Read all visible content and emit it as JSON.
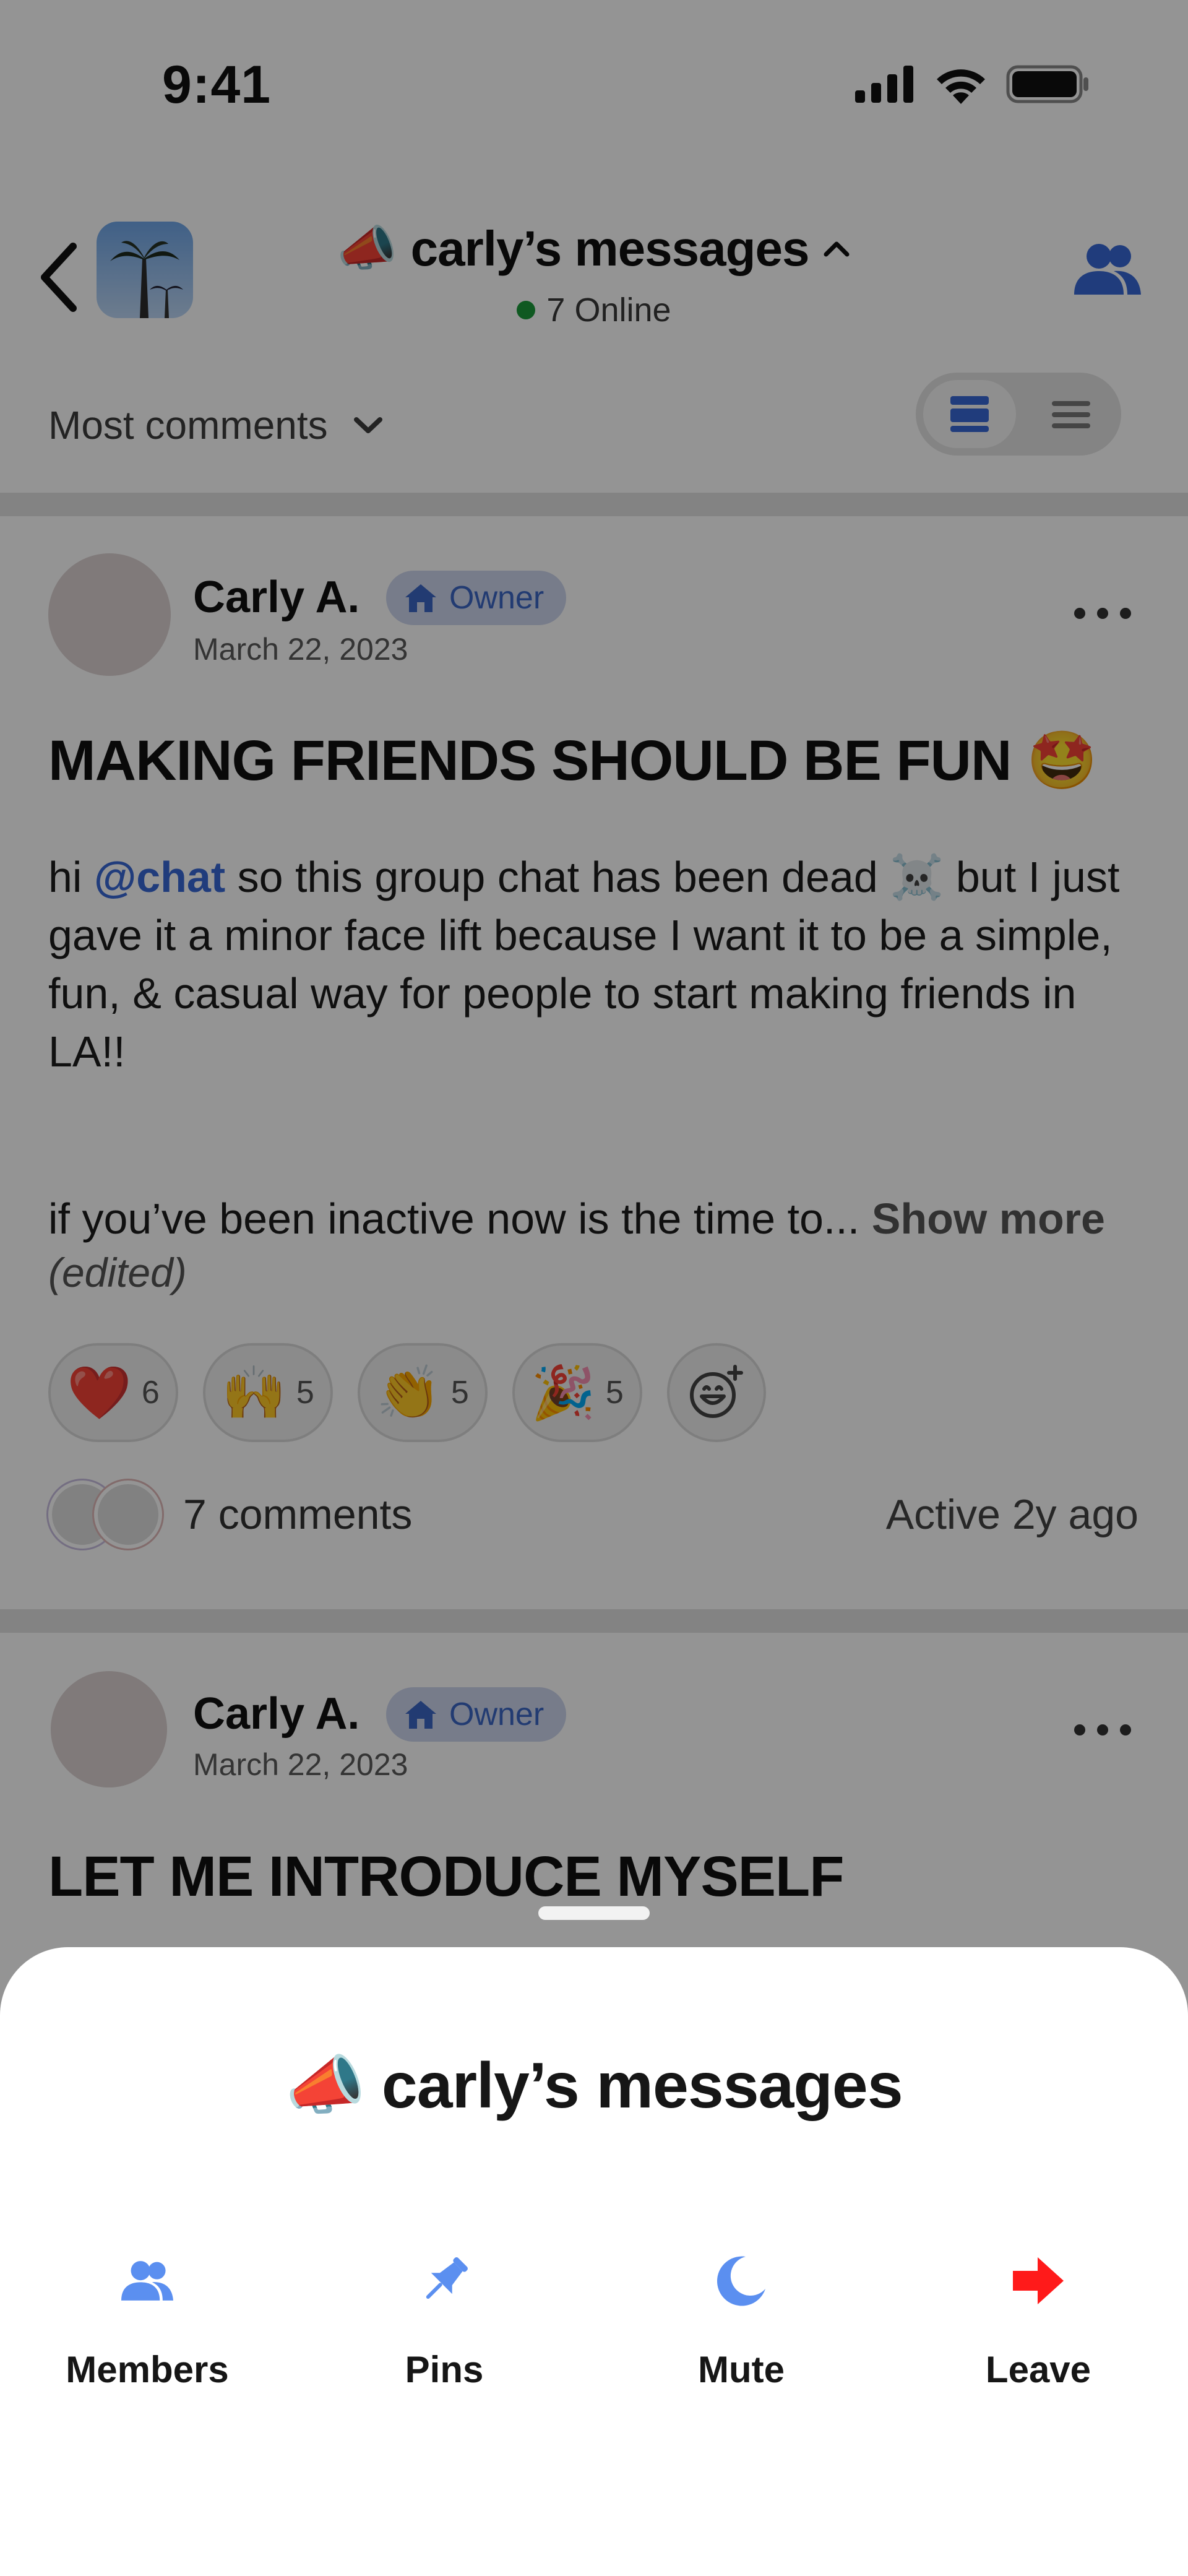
{
  "status_bar": {
    "time": "9:41"
  },
  "header": {
    "group_emoji": "📣",
    "title": "carly’s messages",
    "online_text": "7 Online",
    "sort_label": "Most comments"
  },
  "posts": [
    {
      "author": "Carly A.",
      "badge": "Owner",
      "date": "March 22, 2023",
      "title": "MAKING FRIENDS SHOULD BE FUN 🤩",
      "body_pre": "hi ",
      "mention": "@chat",
      "body_post": " so this group chat has been dead ☠️ but I just gave it a minor face lift because I want it to be a simple, fun, & casual way for people to start making friends in LA!!",
      "body_second": "if you’ve been inactive now is the time to...",
      "show_more": "Show more",
      "edited": "(edited)",
      "reactions": [
        {
          "emoji": "❤️",
          "count": "6"
        },
        {
          "emoji": "🙌",
          "count": "5"
        },
        {
          "emoji": "👏",
          "count": "5"
        },
        {
          "emoji": "🎉",
          "count": "5"
        }
      ],
      "comments": "7 comments",
      "active": "Active 2y ago"
    },
    {
      "author": "Carly A.",
      "badge": "Owner",
      "date": "March 22, 2023",
      "title": "LET ME INTRODUCE MYSELF"
    }
  ],
  "sheet": {
    "emoji": "📣",
    "title": "carly’s messages",
    "actions": [
      {
        "label": "Members",
        "icon": "members-icon"
      },
      {
        "label": "Pins",
        "icon": "pin-icon"
      },
      {
        "label": "Mute",
        "icon": "moon-icon"
      },
      {
        "label": "Leave",
        "icon": "leave-arrow-icon"
      }
    ]
  },
  "colors": {
    "accent": "#3768d6",
    "leave": "#ff1a1a",
    "sheet_icon": "#5b8ff0"
  }
}
